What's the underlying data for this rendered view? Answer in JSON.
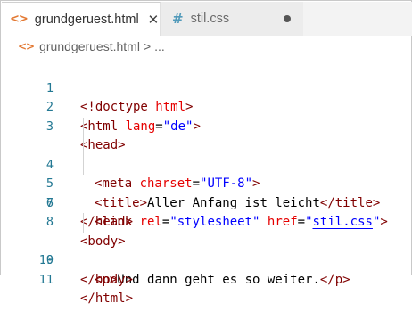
{
  "tabs": [
    {
      "label": "grundgeruest.html",
      "icon": "html-file-icon",
      "active": true
    },
    {
      "label": "stil.css",
      "icon": "css-file-icon",
      "active": false,
      "modified": true
    }
  ],
  "breadcrumb": {
    "file": "grundgeruest.html",
    "sep": ">",
    "more": "..."
  },
  "colors": {
    "tag": "#800000",
    "attribute": "#e50000",
    "value": "#0000ff",
    "line_number": "#237893",
    "html_icon": "#e37933",
    "css_icon": "#519aba"
  },
  "lines": {
    "l1": {
      "n": "1",
      "t": [
        "<!doctype ",
        "html",
        ">"
      ]
    },
    "l2": {
      "n": "2",
      "t": [
        "<html ",
        "lang",
        "=",
        "\"de\"",
        ">"
      ]
    },
    "l3": {
      "n": "3",
      "t": [
        "<head>"
      ]
    },
    "l4": {
      "n": "4",
      "t": [
        "<meta ",
        "charset",
        "=",
        "\"UTF-8\"",
        ">"
      ]
    },
    "l5": {
      "n": "5",
      "t": [
        "<title>",
        "Aller Anfang ist leicht",
        "</title>"
      ]
    },
    "l6": {
      "n": "6",
      "t": [
        "<link ",
        "rel",
        "=",
        "\"stylesheet\"",
        " ",
        "href",
        "=",
        "\"",
        "stil.css",
        "\"",
        ">"
      ]
    },
    "l7": {
      "n": "7",
      "t": [
        "</head>"
      ]
    },
    "l8": {
      "n": "8",
      "t": [
        "<body>"
      ]
    },
    "l9": {
      "n": "9",
      "t": [
        "<p>",
        "Und dann geht es so weiter.",
        "</p>"
      ]
    },
    "l10": {
      "n": "10",
      "t": [
        "</body>"
      ]
    },
    "l11": {
      "n": "11",
      "t": [
        "</html>"
      ]
    }
  }
}
